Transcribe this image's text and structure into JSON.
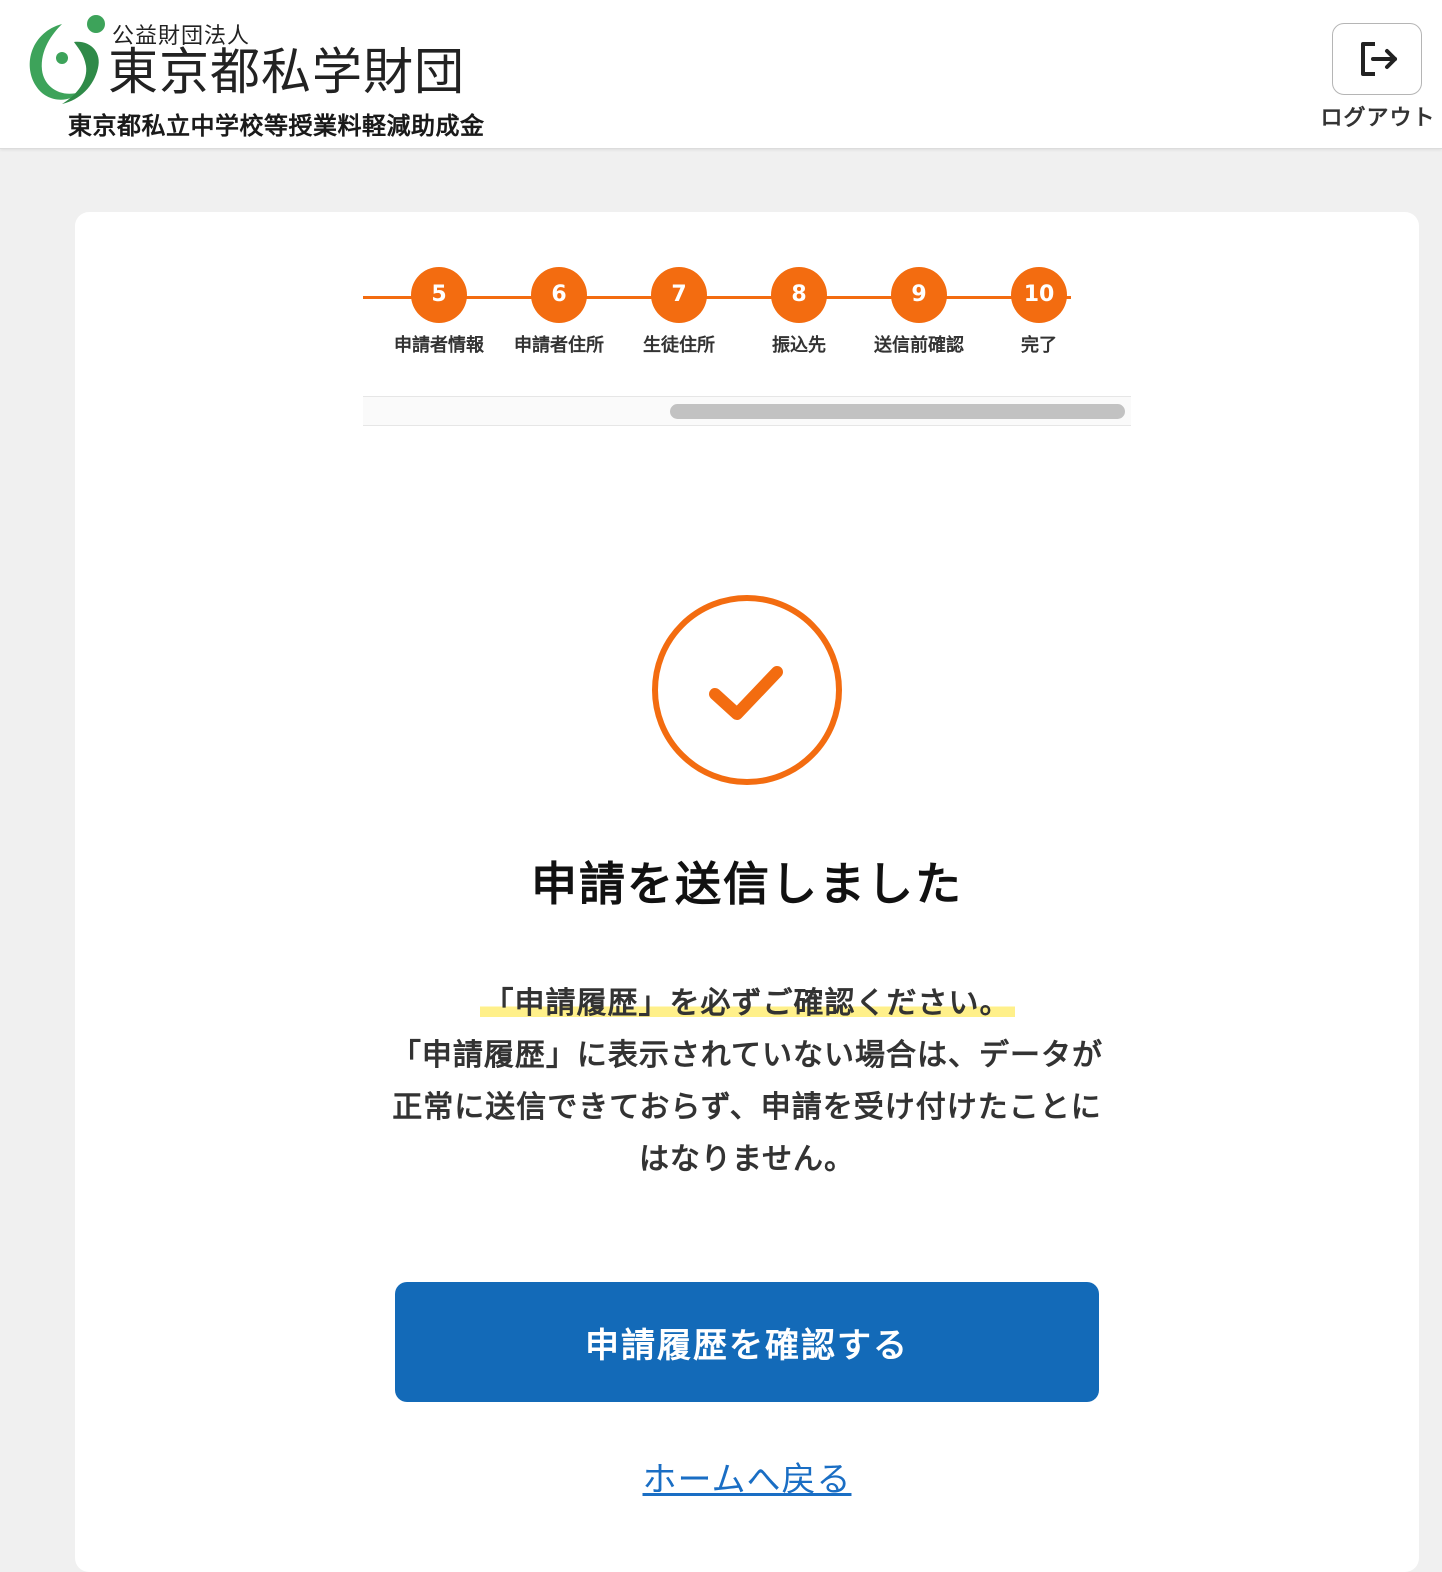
{
  "header": {
    "org_type": "公益財団法人",
    "org_name": "東京都私学財団",
    "program_name": "東京都私立中学校等授業料軽減助成金",
    "logout_label": "ログアウト"
  },
  "stepper": {
    "steps": [
      {
        "number": "5",
        "label": "申請者情報"
      },
      {
        "number": "6",
        "label": "申請者住所"
      },
      {
        "number": "7",
        "label": "生徒住所"
      },
      {
        "number": "8",
        "label": "振込先"
      },
      {
        "number": "9",
        "label": "送信前確認"
      },
      {
        "number": "10",
        "label": "完了"
      }
    ],
    "accent_color": "#f36c10"
  },
  "result": {
    "title": "申請を送信しました",
    "notice_highlight": "「申請履歴」を必ずご確認ください。",
    "notice_body": "「申請履歴」に表示されていない場合は、データが正常に送信できておらず、申請を受け付けたことにはなりません。",
    "primary_button": "申請履歴を確認する",
    "home_link": "ホームへ戻る"
  },
  "colors": {
    "primary": "#136ab8",
    "accent": "#f36c10",
    "logo_green": "#3da35a"
  },
  "icons": {
    "logout": "logout-icon",
    "check": "check-circle-icon",
    "logo": "foundation-logo-icon"
  }
}
